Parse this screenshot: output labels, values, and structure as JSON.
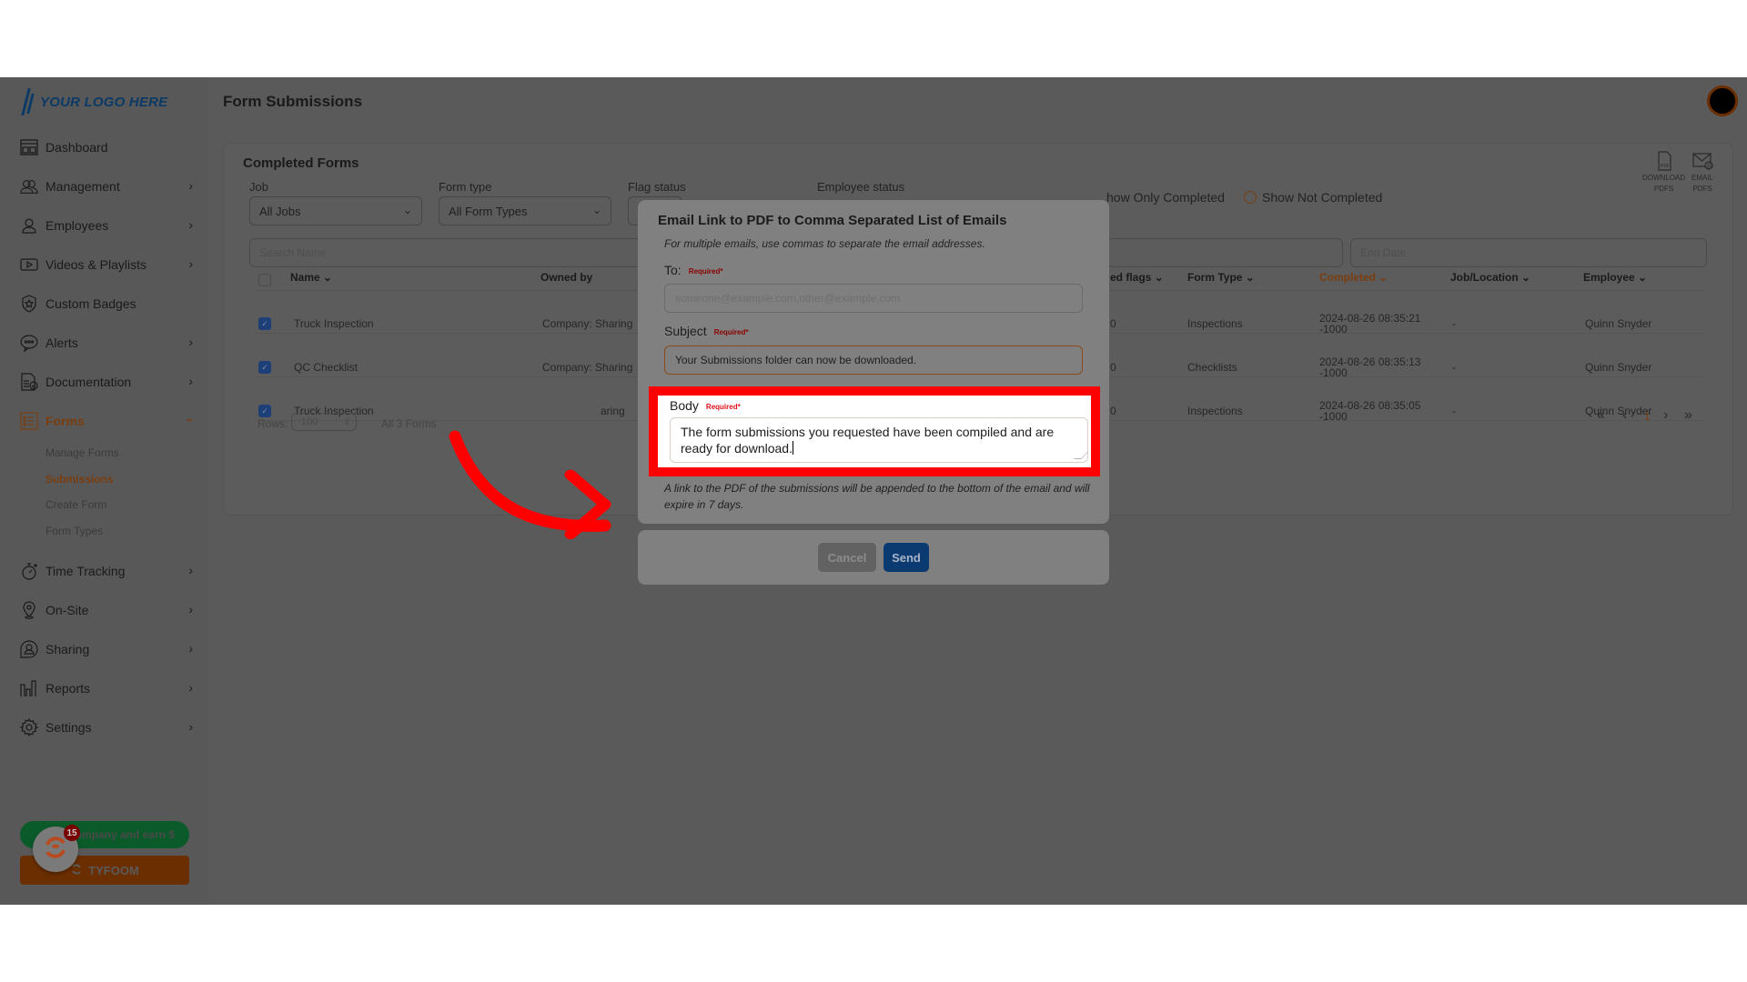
{
  "brand": {
    "logo_text": "YOUR LOGO HERE",
    "accent": "#7a3d10",
    "highlight": "#ff0000"
  },
  "header": {
    "title": "Form Submissions"
  },
  "sidebar": {
    "items": [
      {
        "label": "Dashboard",
        "icon": "dashboard-icon",
        "has_chevron": false
      },
      {
        "label": "Management",
        "icon": "management-icon",
        "has_chevron": true
      },
      {
        "label": "Employees",
        "icon": "employee-icon",
        "has_chevron": true
      },
      {
        "label": "Videos & Playlists",
        "icon": "video-icon",
        "has_chevron": true
      },
      {
        "label": "Custom Badges",
        "icon": "badge-icon",
        "has_chevron": false
      },
      {
        "label": "Alerts",
        "icon": "alert-icon",
        "has_chevron": true
      },
      {
        "label": "Documentation",
        "icon": "document-icon",
        "has_chevron": true
      },
      {
        "label": "Forms",
        "icon": "forms-icon",
        "has_chevron": true,
        "expanded": true,
        "active": true
      },
      {
        "label": "Time Tracking",
        "icon": "stopwatch-icon",
        "has_chevron": true
      },
      {
        "label": "On-Site",
        "icon": "location-pin-icon",
        "has_chevron": true
      },
      {
        "label": "Sharing",
        "icon": "sharing-icon",
        "has_chevron": true
      },
      {
        "label": "Reports",
        "icon": "bar-chart-icon",
        "has_chevron": true
      },
      {
        "label": "Settings",
        "icon": "gear-icon",
        "has_chevron": true
      }
    ],
    "forms_sub": [
      {
        "label": "Manage Forms"
      },
      {
        "label": "Submissions",
        "active": true
      },
      {
        "label": "Create Form"
      },
      {
        "label": "Form Types"
      }
    ],
    "refer_label": "Refer a company and earn $",
    "refer_visible": "ompany and earn $",
    "tyfoom_label": "TYFOOM",
    "notification_count": "15"
  },
  "card": {
    "title": "Completed Forms",
    "filters": {
      "job_label": "Job",
      "job_value": "All Jobs",
      "form_type_label": "Form type",
      "form_type_value": "All Form Types",
      "flag_status_label": "Flag status",
      "employee_status_label": "Employee status",
      "show_only_completed": "how Only Completed",
      "show_not_completed": "Show Not Completed",
      "search_placeholder": "Search Name",
      "end_date_placeholder": "End Date"
    },
    "actions": {
      "download_label_1": "DOWNLOAD",
      "download_label_2": "PDFS",
      "email_label_1": "EMAIL",
      "email_label_2": "PDFS"
    },
    "columns": [
      "Name",
      "Owned by",
      "ed flags",
      "Form Type",
      "Completed",
      "Job/Location",
      "Employee"
    ],
    "rows": [
      {
        "name": "Truck Inspection",
        "owned_by": "Company: Sharing",
        "flags": "0",
        "form_type": "Inspections",
        "completed_1": "2024-08-26 08:35:21",
        "completed_2": "-1000",
        "job": "-",
        "employee": "Quinn Snyder",
        "checked": true
      },
      {
        "name": "QC Checklist",
        "owned_by": "Company: Sharing",
        "flags": "0",
        "form_type": "Checklists",
        "completed_1": "2024-08-26 08:35:13",
        "completed_2": "-1000",
        "job": "-",
        "employee": "Quinn Snyder",
        "checked": true
      },
      {
        "name": "Truck Inspection",
        "owned_by": "aring",
        "flags": "0",
        "form_type": "Inspections",
        "completed_1": "2024-08-26 08:35:05",
        "completed_2": "-1000",
        "job": "-",
        "employee": "Quinn Snyder",
        "checked": true
      }
    ],
    "footer": {
      "rows_label": "Rows:",
      "rows_value": "100",
      "count": "All 3 Forms",
      "page": "1"
    }
  },
  "modal": {
    "title": "Email Link to PDF to Comma Separated List of Emails",
    "hint": "For multiple emails, use commas to separate the email addresses.",
    "to_label": "To:",
    "to_placeholder": "someone@example.com,other@example.com",
    "subject_label": "Subject",
    "subject_value": "Your Submissions folder can now be downloaded.",
    "body_label": "Body",
    "body_value": "The form submissions you requested have been compiled and are ready for download.",
    "required": "Required*",
    "note": "A link to the PDF of the submissions will be appended to the bottom of the email and will expire in 7 days.",
    "cancel_label": "Cancel",
    "send_label": "Send"
  }
}
